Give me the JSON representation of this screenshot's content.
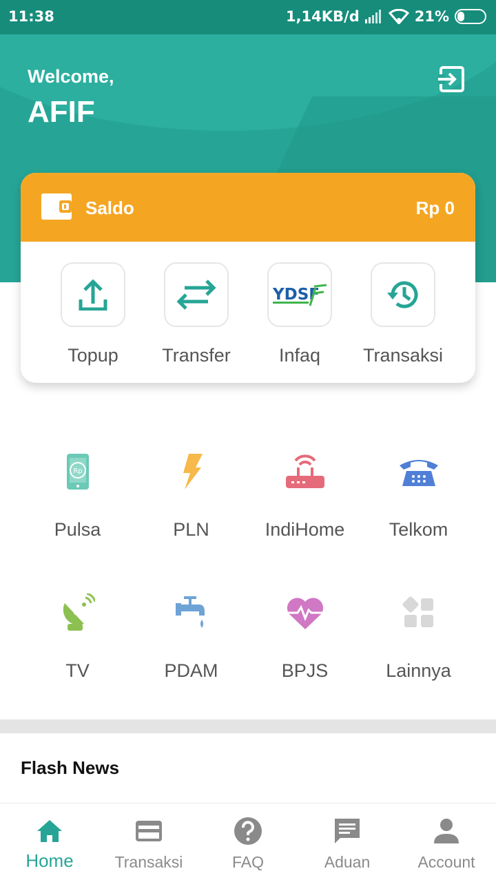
{
  "status_bar": {
    "time": "11:38",
    "network_speed": "1,14KB/d",
    "battery": "21%"
  },
  "header": {
    "greeting": "Welcome,",
    "username": "AFIF",
    "logout_icon": "logout-icon"
  },
  "balance_card": {
    "label": "Saldo",
    "value": "Rp 0",
    "accent_color": "#f4a623",
    "actions": [
      {
        "label": "Topup",
        "icon": "upload-icon"
      },
      {
        "label": "Transfer",
        "icon": "transfer-arrows-icon"
      },
      {
        "label": "Infaq",
        "icon": "ydsf-logo-icon",
        "logo_text": "YDSF"
      },
      {
        "label": "Transaksi",
        "icon": "history-icon"
      }
    ]
  },
  "services": [
    {
      "label": "Pulsa",
      "icon": "phone-rp-icon"
    },
    {
      "label": "PLN",
      "icon": "lightning-icon"
    },
    {
      "label": "IndiHome",
      "icon": "router-icon"
    },
    {
      "label": "Telkom",
      "icon": "telephone-icon"
    },
    {
      "label": "TV",
      "icon": "satellite-dish-icon"
    },
    {
      "label": "PDAM",
      "icon": "water-tap-icon"
    },
    {
      "label": "BPJS",
      "icon": "heart-pulse-icon"
    },
    {
      "label": "Lainnya",
      "icon": "more-grid-icon"
    }
  ],
  "flash_news": {
    "title": "Flash News"
  },
  "bottom_nav": {
    "active_color": "#26a596",
    "items": [
      {
        "label": "Home",
        "icon": "home-icon",
        "active": true
      },
      {
        "label": "Transaksi",
        "icon": "card-icon",
        "active": false
      },
      {
        "label": "FAQ",
        "icon": "question-icon",
        "active": false
      },
      {
        "label": "Aduan",
        "icon": "chat-icon",
        "active": false
      },
      {
        "label": "Account",
        "icon": "person-icon",
        "active": false
      }
    ]
  },
  "theme": {
    "primary": "#26a596",
    "status_bar": "#178c7b"
  }
}
